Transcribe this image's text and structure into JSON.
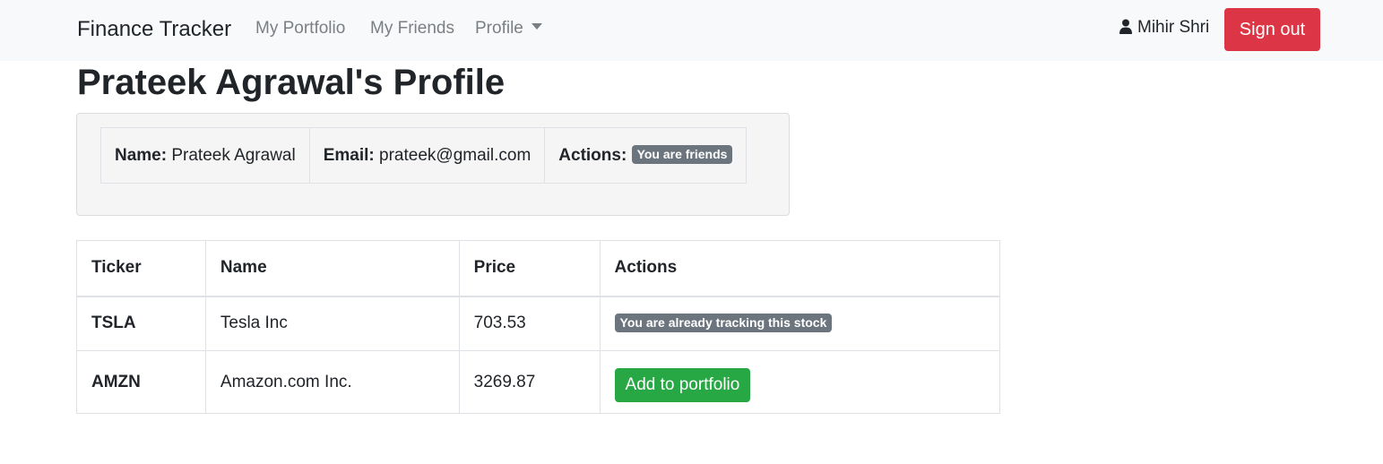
{
  "navbar": {
    "brand": "Finance Tracker",
    "links": [
      "My Portfolio",
      "My Friends",
      "Profile"
    ],
    "user_icon": "user-icon",
    "user_name": "Mihir Shri",
    "signout_label": "Sign out"
  },
  "page": {
    "title": "Prateek Agrawal's Profile"
  },
  "profile": {
    "name_label": "Name:",
    "name_value": "Prateek Agrawal",
    "email_label": "Email:",
    "email_value": "prateek@gmail.com",
    "actions_label": "Actions:",
    "actions_badge": "You are friends"
  },
  "stocks": {
    "headers": [
      "Ticker",
      "Name",
      "Price",
      "Actions"
    ],
    "rows": [
      {
        "ticker": "TSLA",
        "name": "Tesla Inc",
        "price": "703.53",
        "action": "You are already tracking this stock"
      },
      {
        "ticker": "AMZN",
        "name": "Amazon.com Inc.",
        "price": "3269.87",
        "action": "Add to portfolio"
      }
    ]
  },
  "colors": {
    "danger": "#dc3545",
    "success": "#28a745",
    "badge": "#6c757d",
    "navbar_bg": "#f8f9fa"
  }
}
